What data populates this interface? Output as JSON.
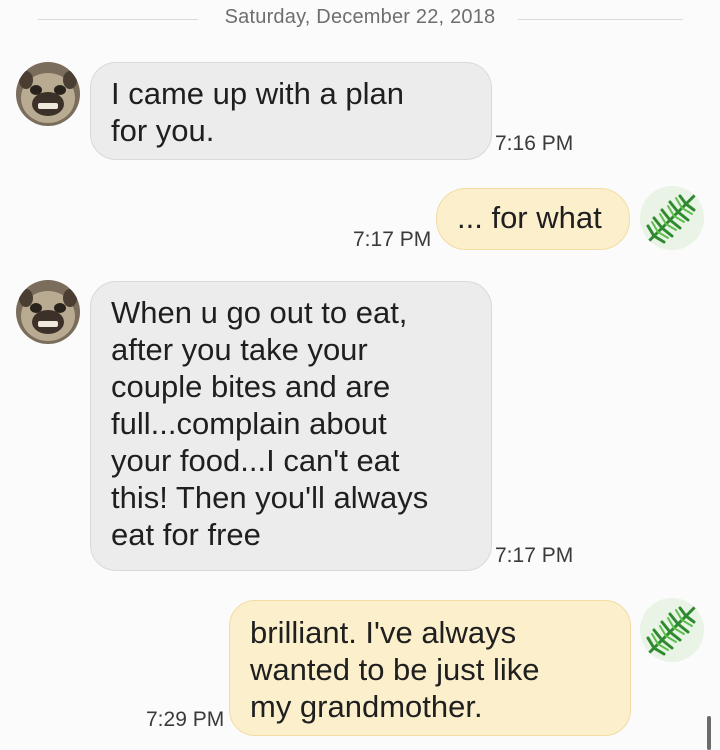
{
  "conversation": {
    "date_label": "Saturday, December 22, 2018",
    "messages": [
      {
        "direction": "incoming",
        "avatar_icon": "pug-avatar-icon",
        "lines": [
          "I came up with a plan",
          "for you."
        ],
        "time": "7:16 PM"
      },
      {
        "direction": "outgoing",
        "avatar_icon": "fern-avatar-icon",
        "lines": [
          "... for what"
        ],
        "time": "7:17 PM"
      },
      {
        "direction": "incoming",
        "avatar_icon": "pug-avatar-icon",
        "lines": [
          "When u go out to eat,",
          "after you take your",
          "couple bites and are",
          "full...complain about",
          "your food...I can't eat",
          "this! Then you'll always",
          "eat for free"
        ],
        "time": "7:17 PM"
      },
      {
        "direction": "outgoing",
        "avatar_icon": "fern-avatar-icon",
        "lines": [
          "brilliant. I've always",
          "wanted to be just like",
          "my grandmother."
        ],
        "time": "7:29 PM"
      }
    ]
  },
  "colors": {
    "incoming_bubble": "#ececec",
    "outgoing_bubble": "#fcefcc",
    "outgoing_border": "#f0dca4",
    "page_background": "#fbfbfb"
  }
}
